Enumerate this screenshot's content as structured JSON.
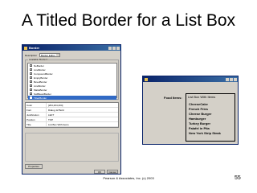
{
  "slide": {
    "title": "A Titled Border for a List Box",
    "footer": "Pearson & Associates, Inc. (c) 2003",
    "page_number": "55"
  },
  "left_window": {
    "title": "Border",
    "description_label": "Description",
    "description_value": "Border Editor",
    "available_label": "Available Borders",
    "borders": [
      {
        "label": "NoBorder",
        "selected": false
      },
      {
        "label": "LineBorder",
        "selected": false
      },
      {
        "label": "CompoundBorder",
        "selected": false
      },
      {
        "label": "EmptyBorder",
        "selected": false
      },
      {
        "label": "BevelBorder",
        "selected": false
      },
      {
        "label": "LineBorder",
        "selected": false
      },
      {
        "label": "MatteBorder",
        "selected": false
      },
      {
        "label": "SoftBevelBorder",
        "selected": false
      },
      {
        "label": "TitledBorder",
        "selected": true
      }
    ],
    "properties": [
      {
        "name": "Color",
        "value": "[204,204,204]"
      },
      {
        "name": "Font",
        "value": "Dialog 12 Bold"
      },
      {
        "name": "Justification",
        "value": "LEFT"
      },
      {
        "name": "Position",
        "value": "TOP"
      },
      {
        "name": "Title",
        "value": "List Box With Items"
      }
    ],
    "properties_button": "Properties",
    "ok_button": "OK",
    "cancel_button": "Cancel"
  },
  "right_window": {
    "food_label": "Food Items:",
    "listbox_title": "List Box With Items",
    "items": [
      "CheeseCake",
      "French Fries",
      "Cheese Burger",
      "Hamburger",
      "Turkey Burger",
      "Falafel in Pita",
      "New York Strip Steak"
    ]
  },
  "colors": {
    "titlebar_start": "#0a246a",
    "titlebar_end": "#3a6ea5",
    "selection": "#316ac5",
    "window_bg": "#d4d0c8"
  }
}
